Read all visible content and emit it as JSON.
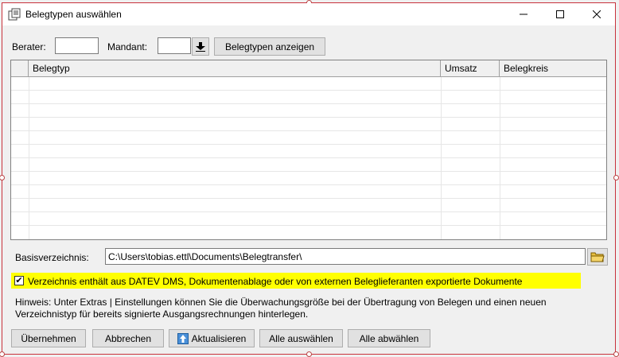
{
  "window": {
    "title": "Belegtypen auswählen"
  },
  "filters": {
    "berater_label": "Berater:",
    "berater_value": "",
    "mandant_label": "Mandant:",
    "mandant_value": "",
    "show_button": "Belegtypen anzeigen"
  },
  "table": {
    "columns": [
      "Belegtyp",
      "Umsatz",
      "Belegkreis"
    ],
    "rows": []
  },
  "basedir": {
    "label": "Basisverzeichnis:",
    "value": "C:\\Users\\tobias.ettl\\Documents\\Belegtransfer\\"
  },
  "checkbox": {
    "label": "Verzeichnis enthält aus DATEV DMS, Dokumentenablage oder von externen Beleglieferanten exportierte Dokumente",
    "checked": true,
    "highlight_color": "#ffff00"
  },
  "hint": {
    "line1": "Hinweis: Unter Extras | Einstellungen können Sie die Überwachungsgröße bei der Übertragung von Belegen und einen neuen",
    "line2": "Verzeichnistyp für bereits signierte Ausgangsrechnungen hinterlegen."
  },
  "buttons": {
    "apply": "Übernehmen",
    "cancel": "Abbrechen",
    "refresh": "Aktualisieren",
    "select_all": "Alle auswählen",
    "deselect_all": "Alle abwählen"
  }
}
